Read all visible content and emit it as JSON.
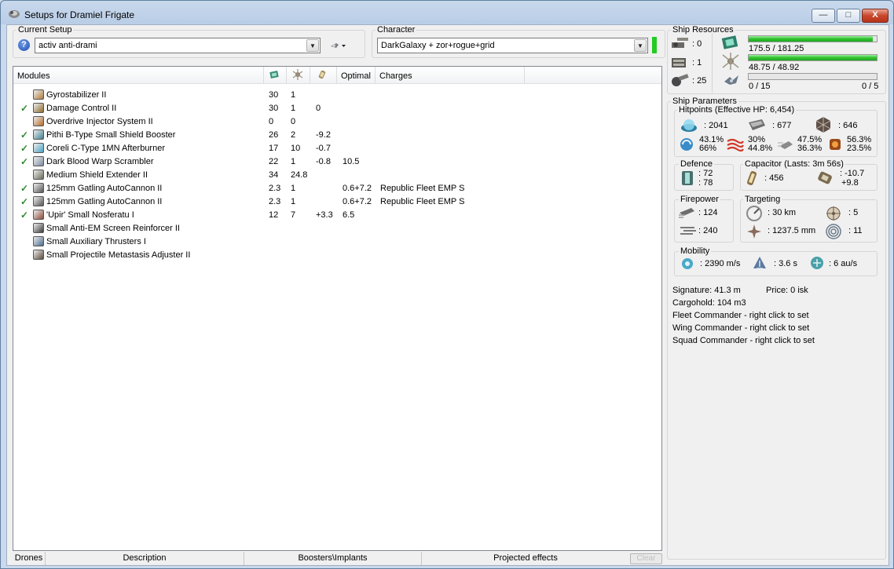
{
  "window": {
    "title": "Setups for Dramiel Frigate",
    "minimize": "—",
    "maximize": "□",
    "close": "X"
  },
  "current_setup": {
    "label": "Current Setup",
    "value": "activ anti-drami",
    "help": "?"
  },
  "character": {
    "label": "Character",
    "value": "DarkGalaxy + zor+rogue+grid",
    "status_color": "#22cc22"
  },
  "modules": {
    "headers": [
      "Modules",
      "",
      "",
      "",
      "Optimal",
      "Charges"
    ],
    "rows": [
      {
        "check": "",
        "name": "Gyrostabilizer II",
        "cpu": "30",
        "pg": "1",
        "cap": "",
        "optimal": "",
        "charges": "",
        "icon_color": "#b07a3a"
      },
      {
        "check": "✓",
        "name": "Damage Control II",
        "cpu": "30",
        "pg": "1",
        "cap": "0",
        "optimal": "",
        "charges": "",
        "icon_color": "#8c6a2c"
      },
      {
        "check": "",
        "name": "Overdrive Injector System II",
        "cpu": "0",
        "pg": "0",
        "cap": "",
        "optimal": "",
        "charges": "",
        "icon_color": "#b36a2a"
      },
      {
        "check": "✓",
        "name": "Pithi B-Type Small Shield Booster",
        "cpu": "26",
        "pg": "2",
        "cap": "-9.2",
        "optimal": "",
        "charges": "",
        "icon_color": "#3f7f8f"
      },
      {
        "check": "✓",
        "name": "Coreli C-Type 1MN Afterburner",
        "cpu": "17",
        "pg": "10",
        "cap": "-0.7",
        "optimal": "",
        "charges": "",
        "icon_color": "#4aa0c0"
      },
      {
        "check": "✓",
        "name": "Dark Blood Warp Scrambler",
        "cpu": "22",
        "pg": "1",
        "cap": "-0.8",
        "optimal": "10.5",
        "charges": "",
        "icon_color": "#7a8ca0"
      },
      {
        "check": "",
        "name": "Medium Shield Extender II",
        "cpu": "34",
        "pg": "24.8",
        "cap": "",
        "optimal": "",
        "charges": "",
        "icon_color": "#6a6a5a"
      },
      {
        "check": "✓",
        "name": "125mm Gatling AutoCannon II",
        "cpu": "2.3",
        "pg": "1",
        "cap": "",
        "optimal": "0.6+7.2",
        "charges": "Republic Fleet EMP S",
        "icon_color": "#555555"
      },
      {
        "check": "✓",
        "name": "125mm Gatling AutoCannon II",
        "cpu": "2.3",
        "pg": "1",
        "cap": "",
        "optimal": "0.6+7.2",
        "charges": "Republic Fleet EMP S",
        "icon_color": "#555555"
      },
      {
        "check": "✓",
        "name": "'Upir' Small Nosferatu I",
        "cpu": "12",
        "pg": "7",
        "cap": "+3.3",
        "optimal": "6.5",
        "charges": "",
        "icon_color": "#8a4a3a"
      },
      {
        "check": "",
        "name": "Small Anti-EM Screen Reinforcer II",
        "cpu": "",
        "pg": "",
        "cap": "",
        "optimal": "",
        "charges": "",
        "icon_color": "#3a3a3a"
      },
      {
        "check": "",
        "name": "Small Auxiliary Thrusters I",
        "cpu": "",
        "pg": "",
        "cap": "",
        "optimal": "",
        "charges": "",
        "icon_color": "#4a6a8a"
      },
      {
        "check": "",
        "name": "Small Projectile Metastasis Adjuster II",
        "cpu": "",
        "pg": "",
        "cap": "",
        "optimal": "",
        "charges": "",
        "icon_color": "#5a4a3a"
      }
    ]
  },
  "tabs": [
    "Drones",
    "Description",
    "Boosters\\Implants",
    "Projected effects",
    "Clear"
  ],
  "ship_resources": {
    "label": "Ship Resources",
    "turrets": ": 0",
    "launchers": ": 1",
    "calibration": ": 25",
    "cpu": {
      "text": "175.5 / 181.25",
      "fill": 0.968
    },
    "powergrid": {
      "text": "48.75 / 48.92",
      "fill": 0.997
    },
    "drone_bw": {
      "text": "0 / 15",
      "fill": 0.0
    },
    "drone_bay": "0 / 5"
  },
  "ship_parameters": {
    "label": "Ship Parameters",
    "hitpoints": {
      "label": "Hitpoints (Effective HP: 6,454)",
      "shield": ": 2041",
      "armor": ": 677",
      "structure": ": 646",
      "resists": [
        {
          "icon": "em-icon",
          "a": "43.1%",
          "b": "66%"
        },
        {
          "icon": "thermal-icon",
          "a": "30%",
          "b": "44.8%"
        },
        {
          "icon": "kinetic-icon",
          "a": "47.5%",
          "b": "36.3%"
        },
        {
          "icon": "explosive-icon",
          "a": "56.3%",
          "b": "23.5%"
        }
      ]
    },
    "defence": {
      "label": "Defence",
      "a": ": 72",
      "b": ": 78"
    },
    "capacitor": {
      "label": "Capacitor (Lasts: 3m 56s)",
      "capacity": ": 456",
      "a": ": -10.7",
      "b": "+9.8"
    },
    "firepower": {
      "label": "Firepower",
      "dps": ": 124",
      "volley": ": 240"
    },
    "targeting": {
      "label": "Targeting",
      "range": ": 30 km",
      "targets": ": 5",
      "resolution": ": 1237.5 mm",
      "sensor": ": 11"
    },
    "mobility": {
      "label": "Mobility",
      "speed": ": 2390 m/s",
      "align": ": 3.6 s",
      "warp": ": 6 au/s"
    }
  },
  "info": {
    "signature": "Signature: 41.3 m",
    "price": "Price: 0 isk",
    "cargohold": "Cargohold: 104 m3",
    "fleet": "Fleet Commander - right click to set",
    "wing": "Wing Commander - right click to set",
    "squad": "Squad Commander - right click to set"
  }
}
